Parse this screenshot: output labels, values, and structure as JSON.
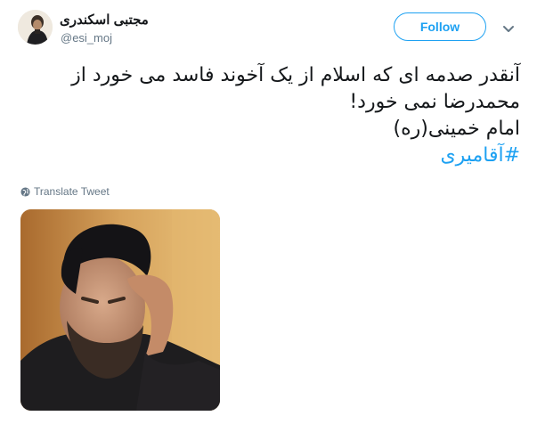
{
  "author": {
    "display_name": "مجتبی اسکندری",
    "handle": "@esi_moj"
  },
  "actions": {
    "follow_label": "Follow",
    "more_icon": "chevron-down-icon"
  },
  "tweet": {
    "lines": [
      "آنقدر صدمه ای که اسلام از یک آخوند فاسد می خورد از",
      "محمدرضا نمی خورد!",
      "امام خمینی(ره)"
    ],
    "hashtag": "#آقامیری"
  },
  "translate": {
    "label": "Translate Tweet",
    "icon": "globe-icon"
  },
  "colors": {
    "accent": "#1da1f2",
    "text": "#14171a",
    "secondary": "#657786"
  }
}
